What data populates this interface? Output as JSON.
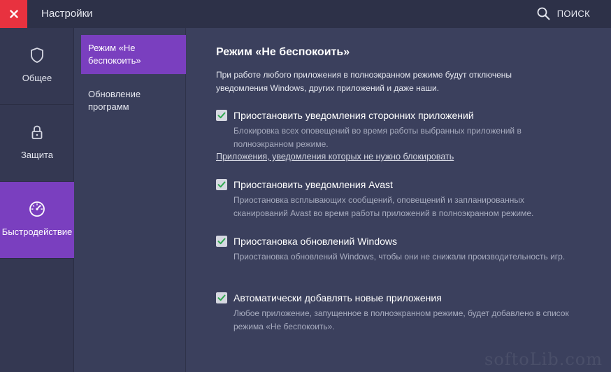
{
  "titlebar": {
    "title": "Настройки",
    "search_label": "ПОИСК",
    "close_icon": "close-icon",
    "search_icon": "search-icon"
  },
  "colors": {
    "accent": "#7a3fbf",
    "close": "#e8323f",
    "check": "#2fa84f"
  },
  "leftnav": {
    "items": [
      {
        "label": "Общее",
        "icon": "shield-icon",
        "active": false
      },
      {
        "label": "Защита",
        "icon": "lock-icon",
        "active": false
      },
      {
        "label": "Быстродействие",
        "icon": "speedometer-icon",
        "active": true
      }
    ]
  },
  "subnav": {
    "items": [
      {
        "label": "Режим «Не беспокоить»",
        "active": true
      },
      {
        "label": "Обновление программ",
        "active": false
      }
    ]
  },
  "main": {
    "title": "Режим «Не беспокоить»",
    "description": "При работе любого приложения в полноэкранном режиме будут отключены уведомления Windows, других приложений и даже наши.",
    "options": [
      {
        "label": "Приостановить уведомления сторонних приложений",
        "description": "Блокировка всех оповещений во время работы выбранных приложений в полноэкранном режиме.",
        "link": "Приложения, уведомления которых не нужно блокировать",
        "checked": true
      },
      {
        "label": "Приостановить уведомления Avast",
        "description": "Приостановка всплывающих сообщений, оповещений и запланированных сканирований Avast во время работы приложений в полноэкранном режиме.",
        "checked": true
      },
      {
        "label": "Приостановка обновлений Windows",
        "description": "Приостановка обновлений Windows, чтобы они не снижали производительность игр.",
        "checked": true
      },
      {
        "label": "Автоматически добавлять новые приложения",
        "description": "Любое приложение, запущенное в полноэкранном режиме, будет добавлено в список режима «Не беспокоить».",
        "checked": true
      }
    ]
  },
  "watermark": "softoLib.com"
}
